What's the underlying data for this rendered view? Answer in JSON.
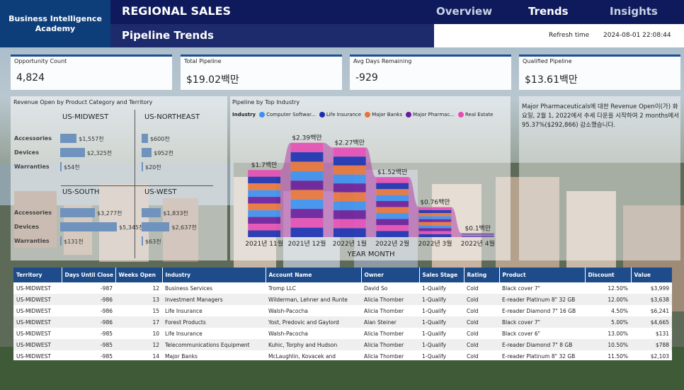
{
  "header": {
    "logo_text": "Business Intelligence Academy",
    "title": "REGIONAL SALES",
    "subtitle": "Pipeline Trends",
    "nav": [
      "Overview",
      "Trends",
      "Insights"
    ],
    "refresh_label": "Refresh time",
    "refresh_value": "2024-08-01 22:08:44"
  },
  "kpis": [
    {
      "label": "Opportunity Count",
      "value": "4,824"
    },
    {
      "label": "Total Pipeline",
      "value": "$19.02백만"
    },
    {
      "label": "Avg Days Remaining",
      "value": "-929"
    },
    {
      "label": "Qualified Pipeline",
      "value": "$13.61백만"
    }
  ],
  "matrix": {
    "title": "Revenue Open by Product Category and Territory",
    "regions": [
      "US-MIDWEST",
      "US-NORTHEAST",
      "US-SOUTH",
      "US-WEST"
    ],
    "rows": [
      "Accessories",
      "Devices",
      "Warranties"
    ],
    "values": {
      "US-MIDWEST": [
        "$1,557천",
        "$2,325천",
        "$54천"
      ],
      "US-NORTHEAST": [
        "$600천",
        "$952천",
        "$20천"
      ],
      "US-SOUTH": [
        "$3,277천",
        "$5,345천",
        "$131천"
      ],
      "US-WEST": [
        "$1,833천",
        "$2,637천",
        "$63천"
      ]
    },
    "numeric": {
      "US-MIDWEST": [
        1557,
        2325,
        54
      ],
      "US-NORTHEAST": [
        600,
        952,
        20
      ],
      "US-SOUTH": [
        3277,
        5345,
        131
      ],
      "US-WEST": [
        1833,
        2637,
        63
      ]
    }
  },
  "chart_data": {
    "type": "area",
    "title": "Pipeline by Top Industry",
    "xlabel": "YEAR MONTH",
    "legend_title": "Industry",
    "categories": [
      "2021년 11월",
      "2021년 12월",
      "2022년 1월",
      "2022년 2월",
      "2022년 3월",
      "2022년 4월"
    ],
    "totals": [
      1.7,
      2.39,
      2.27,
      1.52,
      0.76,
      0.1
    ],
    "total_labels": [
      "$1.7백만",
      "$2.39백만",
      "$2.27백만",
      "$1.52백만",
      "$0.76백만",
      "$0.1백만"
    ],
    "series": [
      {
        "name": "Computer Softwar...",
        "color": "#3b8ff0",
        "values": [
          0.34,
          0.48,
          0.45,
          0.3,
          0.15,
          0.02
        ]
      },
      {
        "name": "Life Insurance",
        "color": "#1a2db0",
        "values": [
          0.34,
          0.48,
          0.45,
          0.31,
          0.15,
          0.02
        ]
      },
      {
        "name": "Major Banks",
        "color": "#e9733a",
        "values": [
          0.34,
          0.48,
          0.46,
          0.3,
          0.16,
          0.02
        ]
      },
      {
        "name": "Major Pharmac...",
        "color": "#6a1b9a",
        "values": [
          0.34,
          0.47,
          0.45,
          0.31,
          0.15,
          0.02
        ]
      },
      {
        "name": "Real Estate",
        "color": "#e64bb4",
        "values": [
          0.34,
          0.48,
          0.46,
          0.3,
          0.15,
          0.02
        ]
      }
    ]
  },
  "narrative": "Major Pharmaceuticals에 대한 Revenue Open이(가) 화요일, 2월 1, 2022에서 추세 다운을 시작하여 2 months에서 95.37%($292,866) 감소했습니다.",
  "table": {
    "columns": [
      "Territory",
      "Days Until Close",
      "Weeks Open",
      "Industry",
      "Account Name",
      "Owner",
      "Sales Stage",
      "Rating",
      "Product",
      "Discount",
      "Value"
    ],
    "rows": [
      [
        "US-MIDWEST",
        "-987",
        "12",
        "Business Services",
        "Tromp LLC",
        "David So",
        "1-Qualify",
        "Cold",
        "Black cover 7\"",
        "12.50%",
        "$3,999"
      ],
      [
        "US-MIDWEST",
        "-986",
        "13",
        "Investment Managers",
        "Wilderman, Lehner and Runte",
        "Alicia Thomber",
        "1-Qualify",
        "Cold",
        "E-reader Platinum 8\" 32 GB",
        "12.00%",
        "$3,638"
      ],
      [
        "US-MIDWEST",
        "-986",
        "15",
        "Life Insurance",
        "Walsh-Pacocha",
        "Alicia Thomber",
        "1-Qualify",
        "Cold",
        "E-reader Diamond 7\" 16 GB",
        "4.50%",
        "$6,241"
      ],
      [
        "US-MIDWEST",
        "-986",
        "17",
        "Forest Products",
        "Yost, Predovic and Gaylord",
        "Alan Steiner",
        "1-Qualify",
        "Cold",
        "Black cover 7\"",
        "5.00%",
        "$4,665"
      ],
      [
        "US-MIDWEST",
        "-985",
        "10",
        "Life Insurance",
        "Walsh-Pacocha",
        "Alicia Thomber",
        "1-Qualify",
        "Cold",
        "Black cover 6\"",
        "13.00%",
        "$131"
      ],
      [
        "US-MIDWEST",
        "-985",
        "12",
        "Telecommunications Equipment",
        "Kuhic, Torphy and Hudson",
        "Alicia Thomber",
        "1-Qualify",
        "Cold",
        "E-reader Diamond 7\" 8 GB",
        "10.50%",
        "$788"
      ],
      [
        "US-MIDWEST",
        "-985",
        "14",
        "Major Banks",
        "McLaughlin, Kovacek and",
        "Alicia Thomber",
        "1-Qualify",
        "Cold",
        "E-reader Platinum 8\" 32 GB",
        "11.50%",
        "$2,103"
      ]
    ]
  }
}
